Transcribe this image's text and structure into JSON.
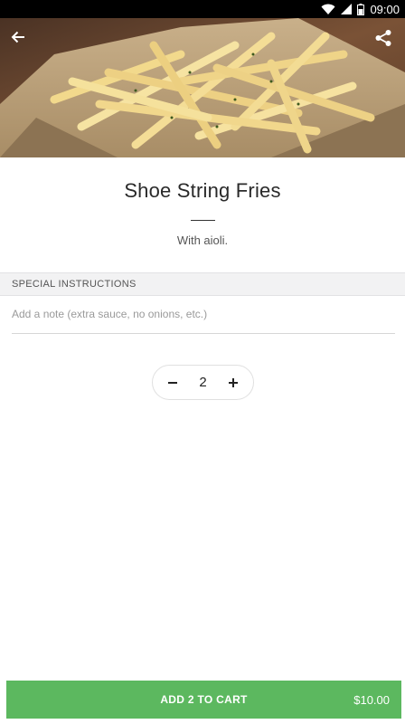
{
  "status_bar": {
    "time": "09:00",
    "icons": [
      "wifi-icon",
      "cell-signal-icon",
      "battery-icon"
    ]
  },
  "header": {
    "back_icon": "arrow-left-icon",
    "share_icon": "share-icon"
  },
  "item": {
    "name": "Shoe String Fries",
    "description": "With aioli."
  },
  "special_instructions": {
    "header": "SPECIAL INSTRUCTIONS",
    "placeholder": "Add a note (extra sauce, no onions, etc.)",
    "value": ""
  },
  "quantity": {
    "value": "2",
    "decrement_icon": "minus-icon",
    "increment_icon": "plus-icon"
  },
  "cart_button": {
    "label": "ADD 2 TO CART",
    "price": "$10.00"
  },
  "colors": {
    "accent": "#5cb85f",
    "status_bar": "#000000",
    "section_header_bg": "#f2f2f3"
  }
}
